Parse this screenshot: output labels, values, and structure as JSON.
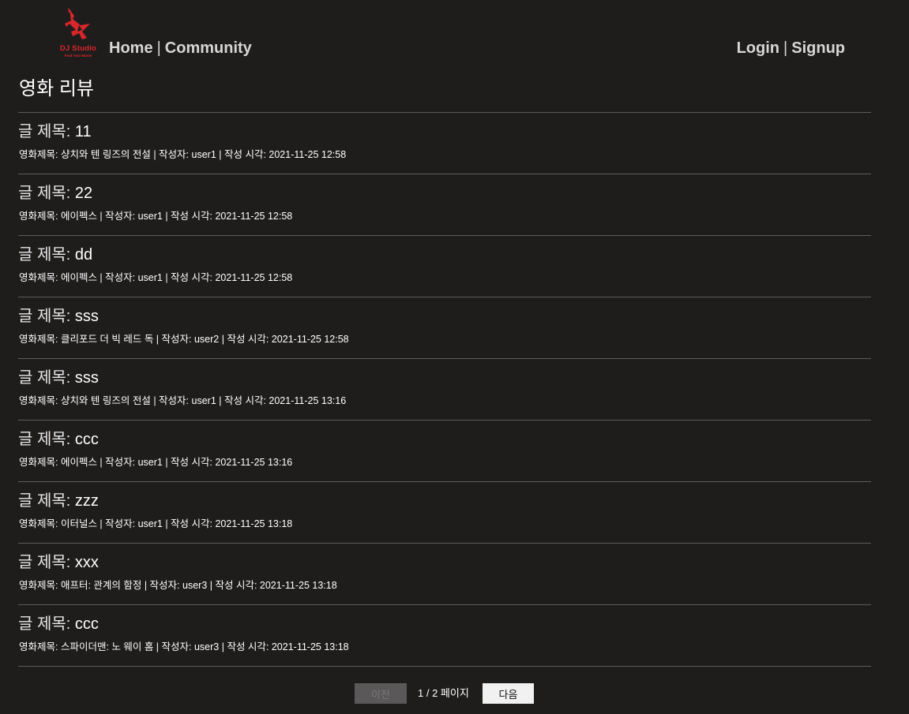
{
  "header": {
    "logo_text": "DJ Studio",
    "logo_tagline": "Find Your Movie",
    "nav_left": [
      {
        "label": "Home"
      },
      {
        "label": "Community"
      }
    ],
    "nav_right": [
      {
        "label": "Login"
      },
      {
        "label": "Signup"
      }
    ],
    "separator": "|",
    "brand_color": "#d9262b"
  },
  "page_title": "영화 리뷰",
  "post_title_label": "글 제목: ",
  "posts": [
    {
      "title": "11",
      "meta": "영화제목: 샹치와 텐 링즈의 전설 | 작성자: user1 | 작성 시각: 2021-11-25 12:58"
    },
    {
      "title": "22",
      "meta": "영화제목: 에이펙스 | 작성자: user1 | 작성 시각: 2021-11-25 12:58"
    },
    {
      "title": "dd",
      "meta": "영화제목: 에이펙스 | 작성자: user1 | 작성 시각: 2021-11-25 12:58"
    },
    {
      "title": "sss",
      "meta": "영화제목: 클리포드 더 빅 레드 독 | 작성자: user2 | 작성 시각: 2021-11-25 12:58"
    },
    {
      "title": "sss",
      "meta": "영화제목: 샹치와 텐 링즈의 전설 | 작성자: user1 | 작성 시각: 2021-11-25 13:16"
    },
    {
      "title": "ccc",
      "meta": "영화제목: 에이펙스 | 작성자: user1 | 작성 시각: 2021-11-25 13:16"
    },
    {
      "title": "zzz",
      "meta": "영화제목: 이터널스 | 작성자: user1 | 작성 시각: 2021-11-25 13:18"
    },
    {
      "title": "xxx",
      "meta": "영화제목: 애프터: 관계의 함정 | 작성자: user3 | 작성 시각: 2021-11-25 13:18"
    },
    {
      "title": "ccc",
      "meta": "영화제목: 스파이더맨: 노 웨이 홈 | 작성자: user3 | 작성 시각: 2021-11-25 13:18"
    }
  ],
  "pagination": {
    "prev_label": "이전",
    "page_info": "1 / 2 페이지",
    "next_label": "다음"
  }
}
